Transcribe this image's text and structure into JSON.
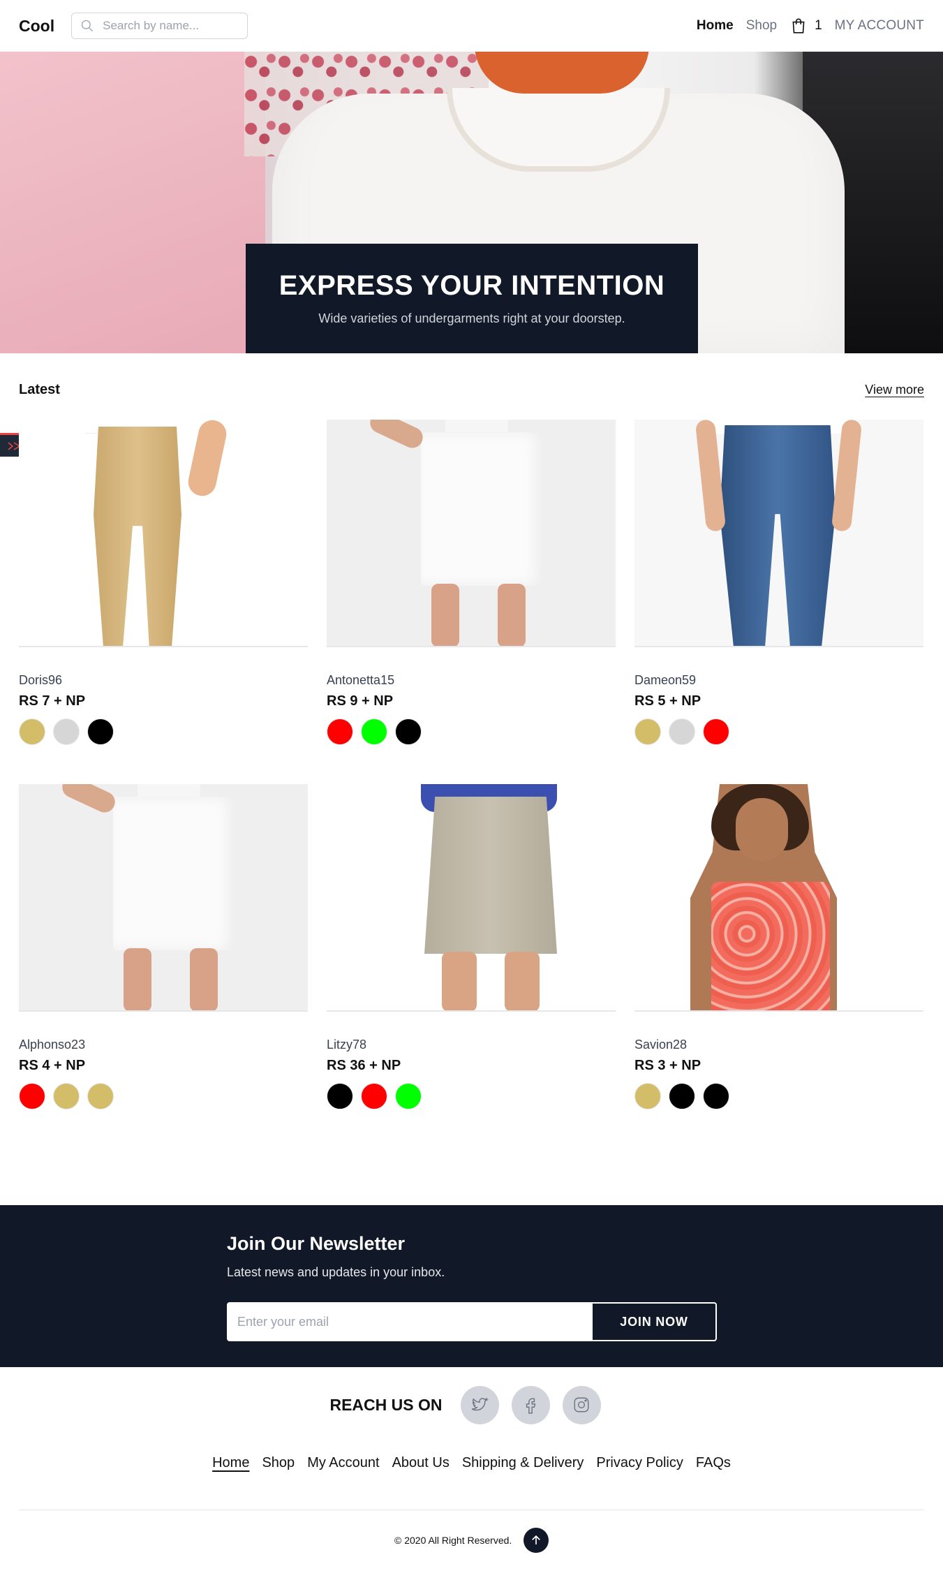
{
  "header": {
    "logo": "Cool",
    "search_placeholder": "Search by name...",
    "nav_home": "Home",
    "nav_shop": "Shop",
    "cart_count": "1",
    "account": "MY ACCOUNT"
  },
  "hero": {
    "title": "EXPRESS YOUR INTENTION",
    "subtitle": "Wide varieties of undergarments right at your doorstep."
  },
  "latest": {
    "title": "Latest",
    "view_more": "View more",
    "products": [
      {
        "name": "Doris96",
        "price": "RS 7 + NP",
        "colors": [
          "#d4bd68",
          "#d6d6d6",
          "#000000"
        ]
      },
      {
        "name": "Antonetta15",
        "price": "RS 9 + NP",
        "colors": [
          "#ff0000",
          "#00ff00",
          "#000000"
        ]
      },
      {
        "name": "Dameon59",
        "price": "RS 5 + NP",
        "colors": [
          "#d4bd68",
          "#d6d6d6",
          "#ff0000"
        ]
      },
      {
        "name": "Alphonso23",
        "price": "RS 4 + NP",
        "colors": [
          "#ff0000",
          "#d4bd68",
          "#d4bd68"
        ]
      },
      {
        "name": "Litzy78",
        "price": "RS 36 + NP",
        "colors": [
          "#000000",
          "#ff0000",
          "#00ff00"
        ]
      },
      {
        "name": "Savion28",
        "price": "RS 3 + NP",
        "colors": [
          "#d4bd68",
          "#000000",
          "#000000"
        ]
      }
    ]
  },
  "newsletter": {
    "title": "Join Our Newsletter",
    "subtitle": "Latest news and updates in your inbox.",
    "email_placeholder": "Enter your email",
    "button": "JOIN NOW"
  },
  "reach": {
    "label": "REACH US ON",
    "icons": [
      "twitter-icon",
      "facebook-icon",
      "instagram-icon"
    ]
  },
  "footer": {
    "links": [
      "Home",
      "Shop",
      "My Account",
      "About Us",
      "Shipping & Delivery",
      "Privacy Policy",
      "FAQs"
    ],
    "copyright": "© 2020 All Right Reserved."
  }
}
